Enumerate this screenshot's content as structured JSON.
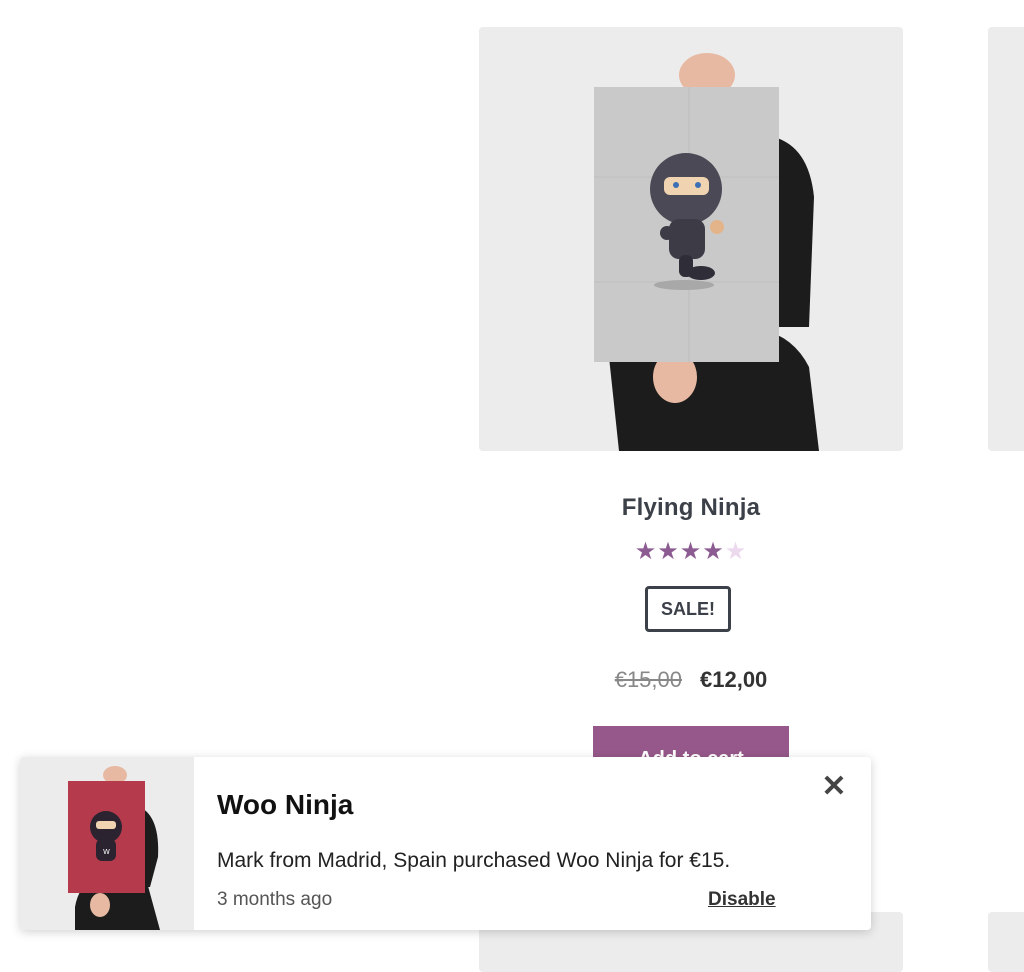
{
  "product": {
    "title": "Flying Ninja",
    "rating": {
      "value": 4,
      "max": 5
    },
    "rating_stars": [
      "★",
      "★",
      "★",
      "★",
      "★"
    ],
    "sale_badge": "SALE!",
    "price_old": "€15,00",
    "price_new": "€12,00",
    "add_to_cart_label": "Add to cart"
  },
  "notification": {
    "title": "Woo Ninja",
    "message": "Mark from Madrid, Spain purchased Woo Ninja for €15.",
    "time_ago": "3 months ago",
    "disable_label": "Disable",
    "close_icon": "close-icon"
  },
  "colors": {
    "accent": "#96588a",
    "star_filled": "#8b5b92",
    "star_empty": "#ecd9ee",
    "card_bg": "#ececec",
    "poster_red": "#b53a4c"
  }
}
